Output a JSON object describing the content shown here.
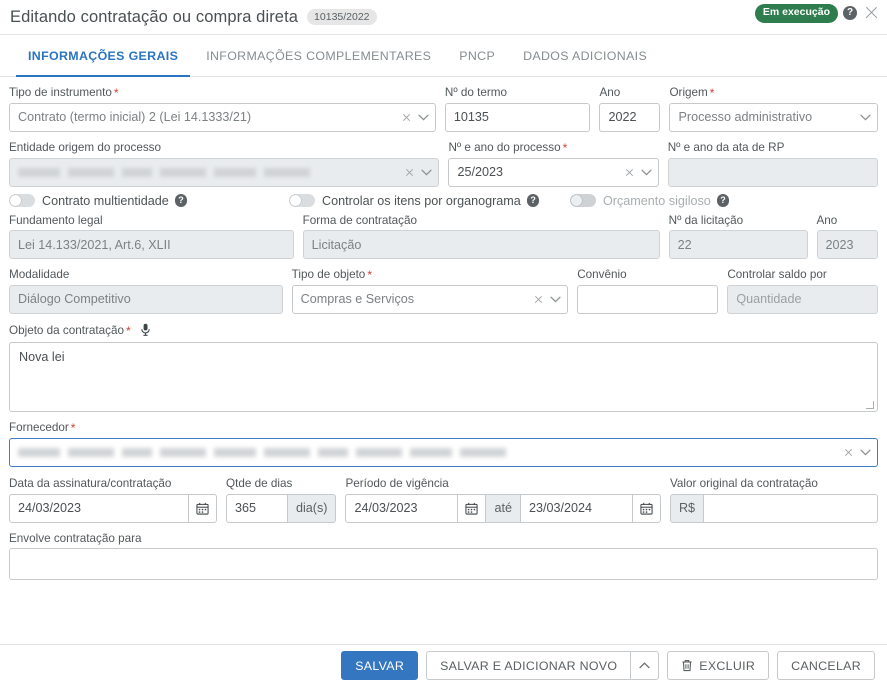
{
  "header": {
    "title": "Editando contratação ou compra direta",
    "id_chip": "10135/2022",
    "status_badge": "Em execução",
    "help_icon": "help-circle-icon",
    "close_icon": "close-icon",
    "badge_color": "#2f7d4e"
  },
  "tabs": [
    {
      "label": "INFORMAÇÕES GERAIS",
      "active": true
    },
    {
      "label": "INFORMAÇÕES COMPLEMENTARES",
      "active": false
    },
    {
      "label": "PNCP",
      "active": false
    },
    {
      "label": "DADOS ADICIONAIS",
      "active": false
    }
  ],
  "accent": "#2a74c4",
  "form": {
    "tipo_instrumento": {
      "label": "Tipo de instrumento",
      "required": true,
      "value": "Contrato (termo inicial) 2 (Lei 14.1333/21)"
    },
    "numero_termo": {
      "label": "Nº do termo",
      "required": false,
      "value": "10135"
    },
    "ano_termo": {
      "label": "Ano",
      "required": false,
      "value": "2022"
    },
    "origem": {
      "label": "Origem",
      "required": true,
      "value": "Processo administrativo"
    },
    "entidade_origem": {
      "label": "Entidade origem do processo",
      "required": false,
      "value": "",
      "redacted": true
    },
    "numero_ano_processo": {
      "label": "Nº e ano do processo",
      "required": true,
      "value": "25/2023"
    },
    "numero_ano_ata_rp": {
      "label": "Nº e ano da ata de RP",
      "required": false,
      "value": "",
      "disabled": true
    },
    "toggles": [
      {
        "label": "Contrato multientidade",
        "on": false,
        "disabled": false
      },
      {
        "label": "Controlar os itens por organograma",
        "on": false,
        "disabled": false
      },
      {
        "label": "Orçamento sigiloso",
        "on": false,
        "disabled": true
      }
    ],
    "fundamento_legal": {
      "label": "Fundamento legal",
      "required": false,
      "value": "Lei 14.133/2021, Art.6, XLII",
      "disabled": true
    },
    "forma_contratacao": {
      "label": "Forma de contratação",
      "required": false,
      "value": "Licitação",
      "disabled": true
    },
    "numero_licitacao": {
      "label": "Nº da licitação",
      "required": false,
      "value": "22",
      "disabled": true
    },
    "ano_licitacao": {
      "label": "Ano",
      "required": false,
      "value": "2023",
      "disabled": true
    },
    "modalidade": {
      "label": "Modalidade",
      "required": false,
      "value": "Diálogo Competitivo",
      "disabled": true
    },
    "tipo_objeto": {
      "label": "Tipo de objeto",
      "required": true,
      "value": "Compras e Serviços"
    },
    "convenio": {
      "label": "Convênio",
      "required": false,
      "value": ""
    },
    "controlar_saldo_por": {
      "label": "Controlar saldo por",
      "required": false,
      "value": "Quantidade",
      "disabled": true
    },
    "objeto_contratacao": {
      "label": "Objeto da contratação",
      "required": true,
      "value": "Nova lei",
      "mic_icon": "microphone-icon"
    },
    "fornecedor": {
      "label": "Fornecedor",
      "required": true,
      "value": "",
      "redacted": true,
      "focused": true
    },
    "data_assinatura": {
      "label": "Data da assinatura/contratação",
      "required": false,
      "value": "24/03/2023",
      "calendar_icon": "calendar-icon"
    },
    "qtde_dias": {
      "label": "Qtde de dias",
      "required": false,
      "value": "365",
      "suffix": "dia(s)"
    },
    "periodo_vigencia": {
      "label": "Período de vigência",
      "required": false,
      "start": "24/03/2023",
      "separator": "até",
      "end": "23/03/2024",
      "calendar_icon": "calendar-icon"
    },
    "valor_original": {
      "label": "Valor original da contratação",
      "required": false,
      "prefix": "R$",
      "value": ""
    },
    "envolve_contratacao_para": {
      "label": "Envolve contratação para",
      "required": false,
      "value": ""
    }
  },
  "footer": {
    "save": "SALVAR",
    "save_add_new": "SALVAR E ADICIONAR NOVO",
    "caret_icon": "chevron-up-icon",
    "delete": "EXCLUIR",
    "delete_icon": "trash-icon",
    "cancel": "CANCELAR",
    "primary_color": "#3476c0"
  }
}
